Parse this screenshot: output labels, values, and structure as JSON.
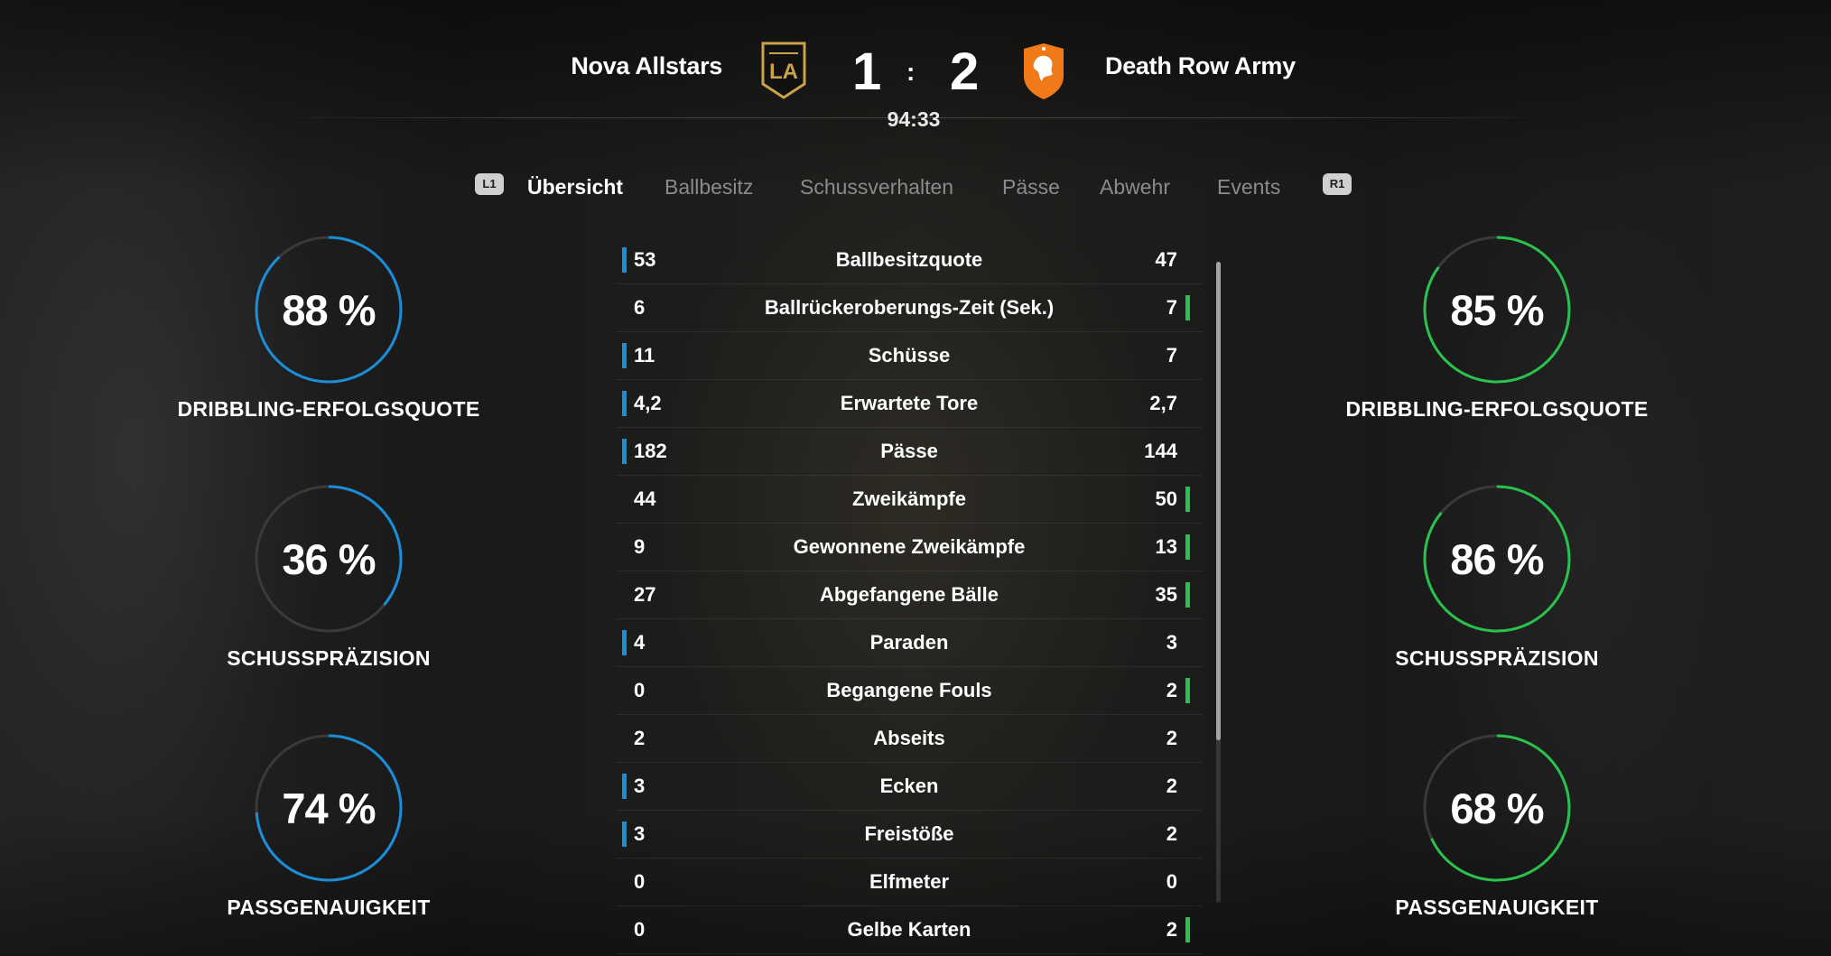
{
  "match": {
    "home_team": "Nova Allstars",
    "away_team": "Death Row Army",
    "home_score": "1",
    "away_score": "2",
    "separator": ":",
    "clock": "94:33",
    "home_crest_icon": "lafc-crest-icon",
    "away_crest_icon": "lion-crest-icon"
  },
  "tabs": {
    "prev_hint": "L1",
    "next_hint": "R1",
    "items": [
      "Übersicht",
      "Ballbesitz",
      "Schussverhalten",
      "Pässe",
      "Abwehr",
      "Events"
    ],
    "active": "Übersicht"
  },
  "colors": {
    "home_accent": "#1a8ed8",
    "away_accent": "#29c24d"
  },
  "home_gauges": [
    {
      "value": "88 %",
      "fraction": 0.88,
      "label": "DRIBBLING-ERFOLGSQUOTE"
    },
    {
      "value": "36 %",
      "fraction": 0.36,
      "label": "SCHUSSPRÄZISION"
    },
    {
      "value": "74 %",
      "fraction": 0.74,
      "label": "PASSGENAUIGKEIT"
    }
  ],
  "away_gauges": [
    {
      "value": "85 %",
      "fraction": 0.85,
      "label": "DRIBBLING-ERFOLGSQUOTE"
    },
    {
      "value": "86 %",
      "fraction": 0.86,
      "label": "SCHUSSPRÄZISION"
    },
    {
      "value": "68 %",
      "fraction": 0.68,
      "label": "PASSGENAUIGKEIT"
    }
  ],
  "stats": [
    {
      "home": "53",
      "label": "Ballbesitzquote",
      "away": "47",
      "lead": "home"
    },
    {
      "home": "6",
      "label": "Ballrückeroberungs-Zeit (Sek.)",
      "away": "7",
      "lead": "away"
    },
    {
      "home": "11",
      "label": "Schüsse",
      "away": "7",
      "lead": "home"
    },
    {
      "home": "4,2",
      "label": "Erwartete Tore",
      "away": "2,7",
      "lead": "home"
    },
    {
      "home": "182",
      "label": "Pässe",
      "away": "144",
      "lead": "home"
    },
    {
      "home": "44",
      "label": "Zweikämpfe",
      "away": "50",
      "lead": "away"
    },
    {
      "home": "9",
      "label": "Gewonnene Zweikämpfe",
      "away": "13",
      "lead": "away"
    },
    {
      "home": "27",
      "label": "Abgefangene Bälle",
      "away": "35",
      "lead": "away"
    },
    {
      "home": "4",
      "label": "Paraden",
      "away": "3",
      "lead": "home"
    },
    {
      "home": "0",
      "label": "Begangene Fouls",
      "away": "2",
      "lead": "away"
    },
    {
      "home": "2",
      "label": "Abseits",
      "away": "2",
      "lead": "none"
    },
    {
      "home": "3",
      "label": "Ecken",
      "away": "2",
      "lead": "home"
    },
    {
      "home": "3",
      "label": "Freistöße",
      "away": "2",
      "lead": "home"
    },
    {
      "home": "0",
      "label": "Elfmeter",
      "away": "0",
      "lead": "none"
    },
    {
      "home": "0",
      "label": "Gelbe Karten",
      "away": "2",
      "lead": "away"
    }
  ]
}
